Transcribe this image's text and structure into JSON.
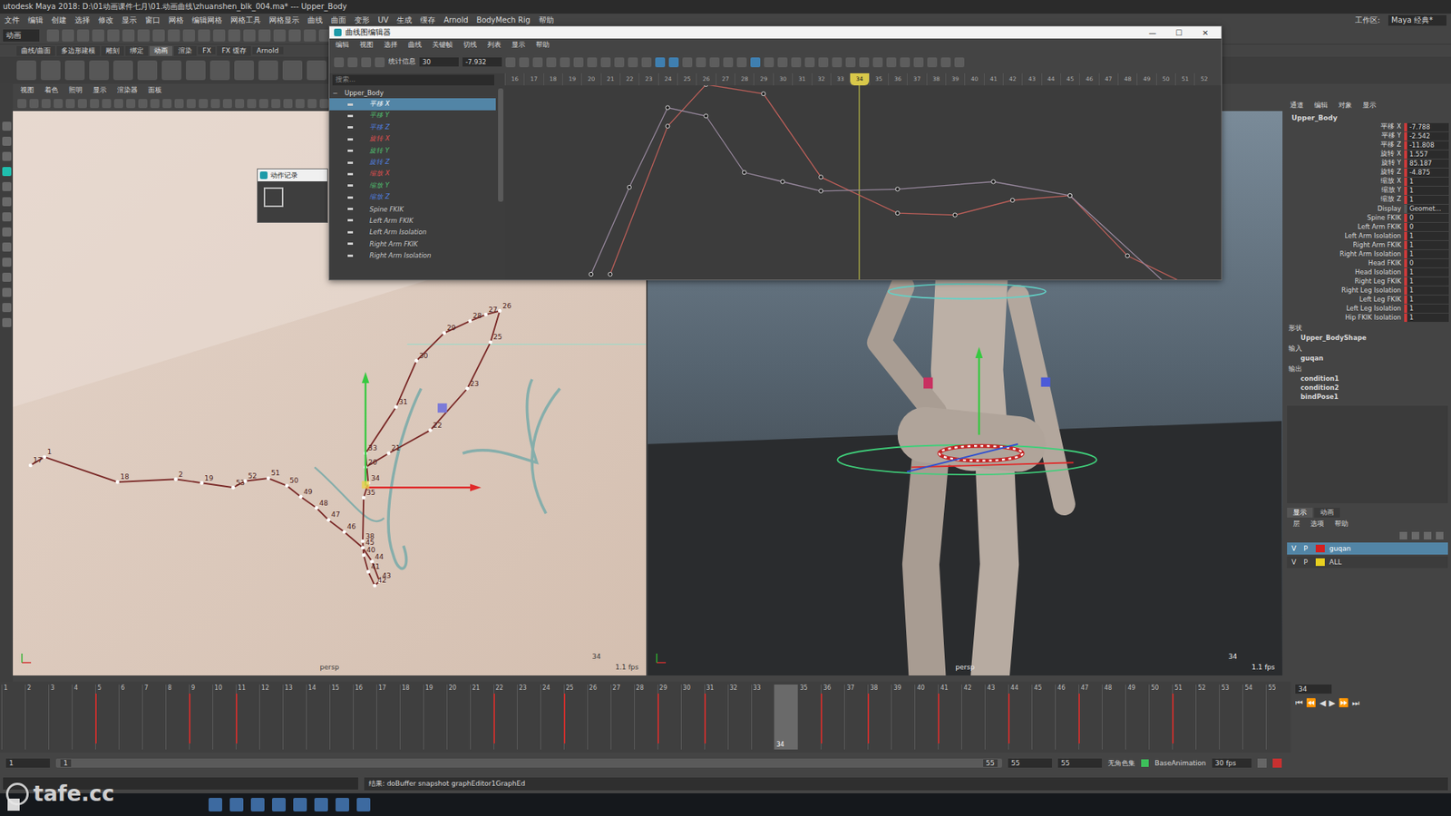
{
  "window": {
    "title": "utodesk Maya 2018: D:\\01动画课件七月\\01.动画曲线\\zhuanshen_blk_004.ma*  ---  Upper_Body",
    "workspace_label": "工作区:",
    "workspace": "Maya 经典*"
  },
  "menubar": [
    "文件",
    "编辑",
    "创建",
    "选择",
    "修改",
    "显示",
    "窗口",
    "网格",
    "编辑网格",
    "网格工具",
    "网格显示",
    "曲线",
    "曲面",
    "变形",
    "UV",
    "生成",
    "缓存",
    "Arnold",
    "BodyMech Rig",
    "帮助"
  ],
  "status_line": {
    "mode": "动画"
  },
  "shelf_tabs": [
    {
      "label": "曲线/曲面",
      "selected": false
    },
    {
      "label": "多边形建模",
      "selected": false
    },
    {
      "label": "雕刻",
      "selected": false
    },
    {
      "label": "绑定",
      "selected": false
    },
    {
      "label": "动画",
      "selected": true
    },
    {
      "label": "渲染",
      "selected": false
    },
    {
      "label": "FX",
      "selected": false
    },
    {
      "label": "FX 缓存",
      "selected": false
    },
    {
      "label": "Arnold",
      "selected": false
    }
  ],
  "panel_menu": [
    "视图",
    "着色",
    "照明",
    "显示",
    "渲染器",
    "面板"
  ],
  "viewports": [
    {
      "camera": "persp",
      "fps": "1.1 fps",
      "frame": "34"
    },
    {
      "camera": "persp",
      "fps": "1.1 fps",
      "frame": "34"
    }
  ],
  "trail": [
    {
      "frame": "17"
    },
    {
      "frame": "1"
    },
    {
      "frame": "18"
    },
    {
      "frame": "2"
    },
    {
      "frame": "19"
    },
    {
      "frame": "53"
    },
    {
      "frame": "52"
    },
    {
      "frame": "51"
    },
    {
      "frame": "50"
    },
    {
      "frame": "49"
    },
    {
      "frame": "48"
    },
    {
      "frame": "47"
    },
    {
      "frame": "46"
    },
    {
      "frame": "45"
    },
    {
      "frame": "44"
    },
    {
      "frame": "43"
    },
    {
      "frame": "42"
    },
    {
      "frame": "41"
    },
    {
      "frame": "40"
    },
    {
      "frame": "38"
    },
    {
      "frame": "35"
    },
    {
      "frame": "34"
    },
    {
      "frame": "33"
    },
    {
      "frame": "31"
    },
    {
      "frame": "30"
    },
    {
      "frame": "29"
    },
    {
      "frame": "28"
    },
    {
      "frame": "27"
    },
    {
      "frame": "26"
    },
    {
      "frame": "25"
    },
    {
      "frame": "23"
    },
    {
      "frame": "22"
    },
    {
      "frame": "21"
    },
    {
      "frame": "20"
    }
  ],
  "mini_dialog": {
    "title": "动作记录"
  },
  "graph_editor": {
    "title": "曲线图编辑器",
    "controls": [
      "—",
      "☐",
      "✕"
    ],
    "menus": [
      "编辑",
      "视图",
      "选择",
      "曲线",
      "关键帧",
      "切线",
      "列表",
      "显示",
      "帮助"
    ],
    "stats_label": "统计信息",
    "stats_value": "30",
    "value_field": "-7.932",
    "search_placeholder": "搜索...",
    "root": "Upper_Body",
    "channels": [
      {
        "name": "平移 X",
        "color": "#e05050",
        "selected": true
      },
      {
        "name": "平移 Y",
        "color": "#50c070",
        "selected": false
      },
      {
        "name": "平移 Z",
        "color": "#5080e0",
        "selected": false
      },
      {
        "name": "旋转 X",
        "color": "#e05050",
        "selected": false
      },
      {
        "name": "旋转 Y",
        "color": "#50c070",
        "selected": false
      },
      {
        "name": "旋转 Z",
        "color": "#5080e0",
        "selected": false
      },
      {
        "name": "缩放 X",
        "color": "#e05050",
        "selected": false
      },
      {
        "name": "缩放 Y",
        "color": "#50c070",
        "selected": false
      },
      {
        "name": "缩放 Z",
        "color": "#5080e0",
        "selected": false
      },
      {
        "name": "Spine FKIK",
        "color": "#c8c8c8",
        "selected": false
      },
      {
        "name": "Left Arm FKIK",
        "color": "#c8c8c8",
        "selected": false
      },
      {
        "name": "Left Arm Isolation",
        "color": "#c8c8c8",
        "selected": false
      },
      {
        "name": "Right Arm FKIK",
        "color": "#c8c8c8",
        "selected": false
      },
      {
        "name": "Right Arm Isolation",
        "color": "#c8c8c8",
        "selected": false
      }
    ],
    "ruler": [
      "16",
      "17",
      "18",
      "19",
      "20",
      "21",
      "22",
      "23",
      "24",
      "25",
      "26",
      "27",
      "28",
      "29",
      "30",
      "31",
      "32",
      "33",
      "34",
      "35",
      "36",
      "37",
      "38",
      "39",
      "40",
      "41",
      "42",
      "43",
      "44",
      "45",
      "46",
      "47",
      "48",
      "49",
      "50",
      "51",
      "52"
    ],
    "current_frame": "34",
    "curves": [
      {
        "name": "平移 X",
        "color": "#c0605a",
        "keys": [
          [
            21,
            -10
          ],
          [
            24,
            6
          ],
          [
            26,
            10.5
          ],
          [
            29,
            9.5
          ],
          [
            32,
            0.5
          ],
          [
            36,
            -3.4
          ],
          [
            39,
            -3.6
          ],
          [
            42,
            -2
          ],
          [
            45,
            -1.5
          ],
          [
            48,
            -8
          ],
          [
            51,
            -11
          ]
        ]
      },
      {
        "name": "平移 Z",
        "color": "#9a8aa0",
        "keys": [
          [
            20,
            -10
          ],
          [
            22,
            -0.6
          ],
          [
            24,
            8
          ],
          [
            26,
            7.1
          ],
          [
            28,
            1
          ],
          [
            30,
            0
          ],
          [
            32,
            -1
          ],
          [
            36,
            -0.8
          ],
          [
            41,
            0
          ],
          [
            45,
            -1.5
          ],
          [
            50,
            -11
          ]
        ]
      }
    ]
  },
  "channel_box": {
    "tabs": [
      "通道",
      "编辑",
      "对象",
      "显示"
    ],
    "object": "Upper_Body",
    "attributes": [
      {
        "name": "平移 X",
        "value": "-7.788",
        "keyed": true
      },
      {
        "name": "平移 Y",
        "value": "-2.542",
        "keyed": true
      },
      {
        "name": "平移 Z",
        "value": "-11.808",
        "keyed": true
      },
      {
        "name": "旋转 X",
        "value": "1.557",
        "keyed": true
      },
      {
        "name": "旋转 Y",
        "value": "85.187",
        "keyed": true
      },
      {
        "name": "旋转 Z",
        "value": "-4.875",
        "keyed": true
      },
      {
        "name": "缩放 X",
        "value": "1",
        "keyed": true
      },
      {
        "name": "缩放 Y",
        "value": "1",
        "keyed": true
      },
      {
        "name": "缩放 Z",
        "value": "1",
        "keyed": true
      },
      {
        "name": "Display",
        "value": "Geomet...",
        "keyed": false
      },
      {
        "name": "Spine FKIK",
        "value": "0",
        "keyed": true
      },
      {
        "name": "Left Arm FKIK",
        "value": "0",
        "keyed": true
      },
      {
        "name": "Left Arm Isolation",
        "value": "1",
        "keyed": true
      },
      {
        "name": "Right Arm FKIK",
        "value": "1",
        "keyed": true
      },
      {
        "name": "Right Arm Isolation",
        "value": "1",
        "keyed": true
      },
      {
        "name": "Head FKIK",
        "value": "0",
        "keyed": true
      },
      {
        "name": "Head Isolation",
        "value": "1",
        "keyed": true
      },
      {
        "name": "Right Leg FKIK",
        "value": "1",
        "keyed": true
      },
      {
        "name": "Right Leg Isolation",
        "value": "1",
        "keyed": true
      },
      {
        "name": "Left Leg FKIK",
        "value": "1",
        "keyed": true
      },
      {
        "name": "Left Leg Isolation",
        "value": "1",
        "keyed": true
      },
      {
        "name": "Hip FKIK Isolation",
        "value": "1",
        "keyed": true
      }
    ],
    "shapes_header": "形状",
    "shape": "Upper_BodyShape",
    "inputs_header": "输入",
    "inputs": [
      "guqan"
    ],
    "outputs_header": "输出",
    "outputs": [
      "condition1",
      "condition2",
      "bindPose1"
    ]
  },
  "layer_editor": {
    "tabs": [
      {
        "label": "显示",
        "selected": true
      },
      {
        "label": "动画",
        "selected": false
      }
    ],
    "menus": [
      "层",
      "选项",
      "帮助"
    ],
    "layers": [
      {
        "v": "V",
        "p": "P",
        "name": "guqan",
        "color": "#d42020",
        "selected": true
      },
      {
        "v": "V",
        "p": "P",
        "name": "ALL",
        "color": "#e8d020",
        "selected": false
      }
    ]
  },
  "timeline": {
    "frames": [
      "1",
      "2",
      "3",
      "4",
      "5",
      "6",
      "7",
      "8",
      "9",
      "10",
      "11",
      "12",
      "13",
      "14",
      "15",
      "16",
      "17",
      "18",
      "19",
      "20",
      "21",
      "22",
      "23",
      "24",
      "25",
      "26",
      "27",
      "28",
      "29",
      "30",
      "31",
      "32",
      "33",
      "34",
      "35",
      "36",
      "37",
      "38",
      "39",
      "40",
      "41",
      "42",
      "43",
      "44",
      "45",
      "46",
      "47",
      "48",
      "49",
      "50",
      "51",
      "52",
      "53",
      "54",
      "55"
    ],
    "keys": [
      5,
      9,
      11,
      22,
      25,
      29,
      31,
      36,
      38,
      41,
      44,
      47,
      51
    ],
    "current_frame": "34",
    "frame_field": "34",
    "buttons": [
      "⏮",
      "⏪",
      "◀",
      "▶",
      "⏩",
      "⏭"
    ]
  },
  "range_slider": {
    "start": "1",
    "inner_start": "1",
    "inner_end": "55",
    "end": "55",
    "anim_end": "55",
    "character_set": "无角色集",
    "layer": "BaseAnimation",
    "fps": "30 fps"
  },
  "command_line": {
    "result": "结果: doBuffer snapshot graphEditor1GraphEd"
  },
  "watermark": "tafe.cc"
}
